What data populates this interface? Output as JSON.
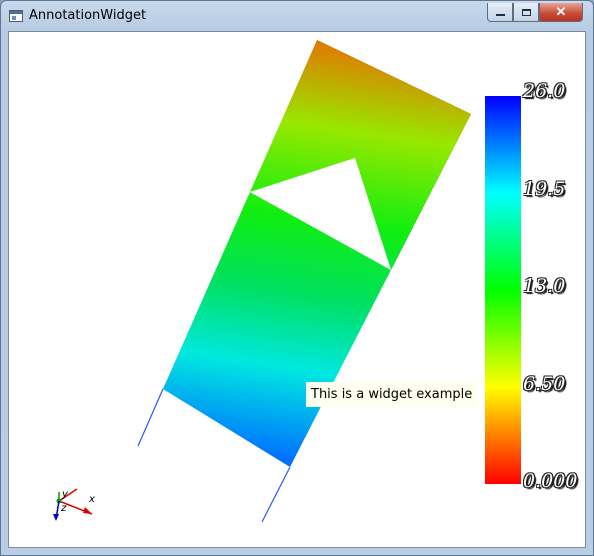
{
  "window": {
    "title": "AnnotationWidget",
    "controls": {
      "minimize": "minimize",
      "maximize": "maximize",
      "close": "✕"
    }
  },
  "annotation": {
    "text": "This is a widget example"
  },
  "scalar_bar": {
    "labels": [
      "26.0",
      "19.5",
      "13.0",
      "6.50",
      "0.000"
    ],
    "range": [
      0.0,
      26.0
    ],
    "colors": {
      "high": "#0000ff",
      "mid_high": "#00ffff",
      "mid": "#00ff00",
      "mid_low": "#ffff00",
      "low": "#ff0000"
    }
  },
  "orientation_axes": {
    "x": "x",
    "y": "y",
    "z": "z"
  }
}
